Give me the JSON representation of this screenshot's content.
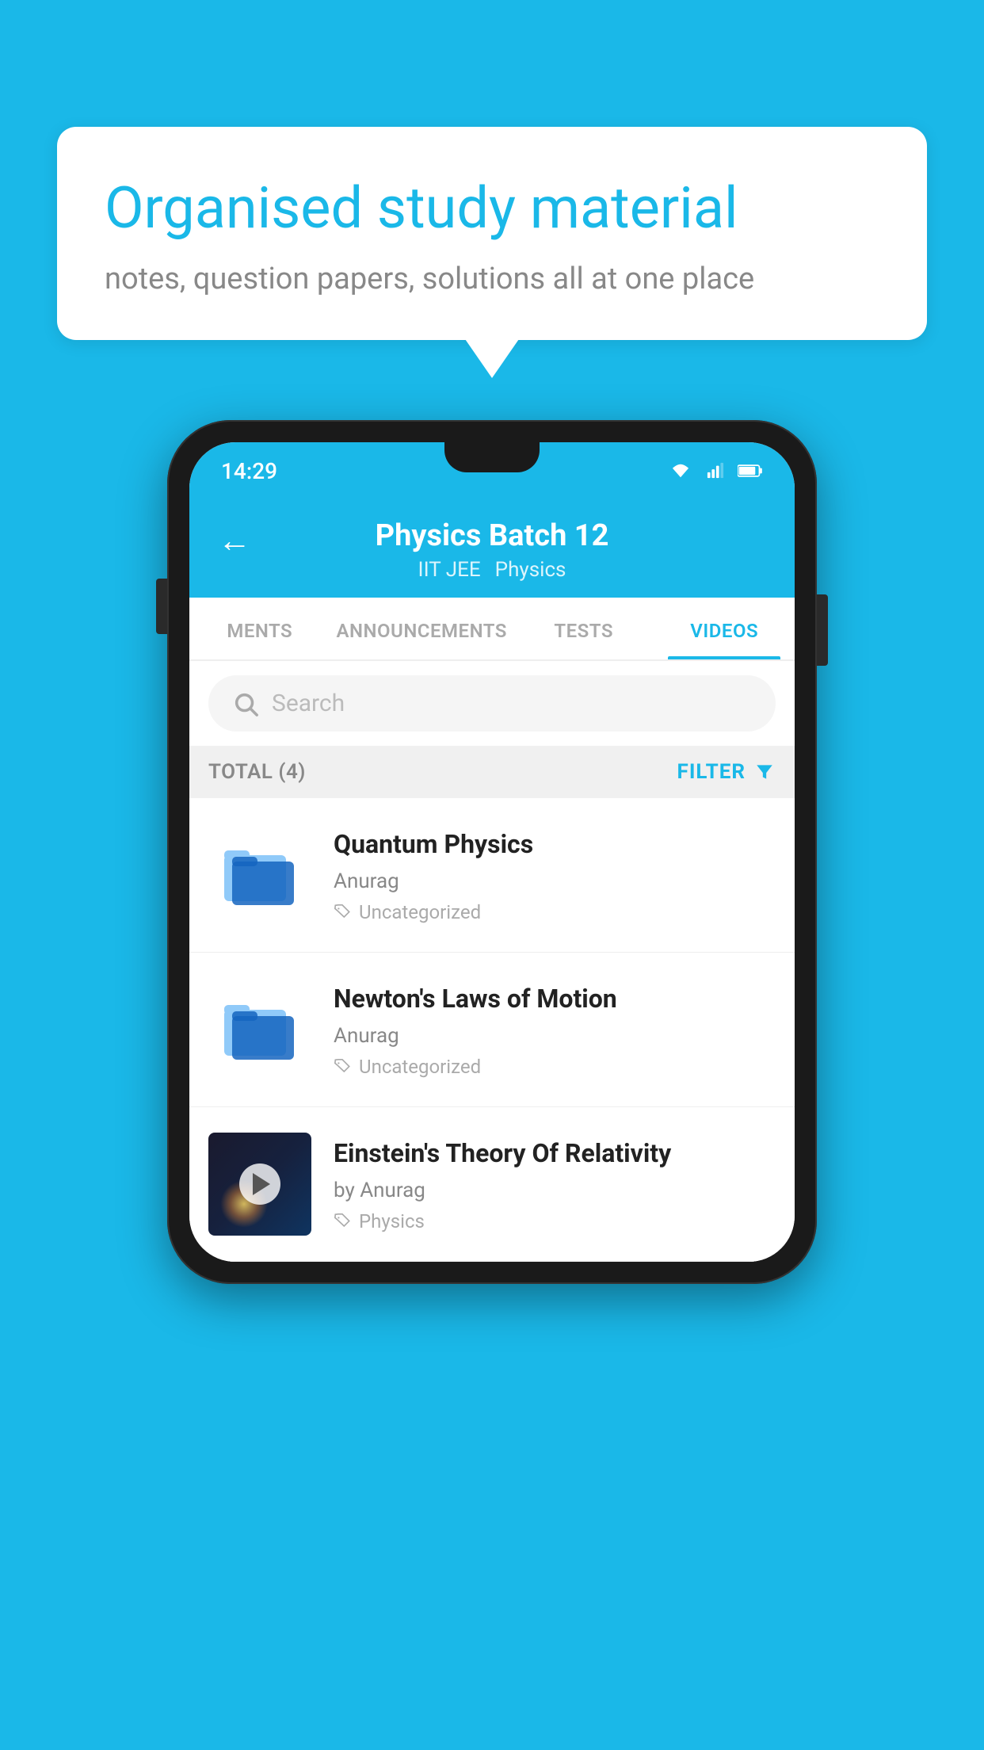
{
  "background_color": "#1ab8e8",
  "speech_bubble": {
    "title": "Organised study material",
    "subtitle": "notes, question papers, solutions all at one place"
  },
  "phone": {
    "status_bar": {
      "time": "14:29"
    },
    "header": {
      "back_label": "←",
      "title": "Physics Batch 12",
      "tag1": "IIT JEE",
      "tag2": "Physics"
    },
    "tabs": [
      {
        "label": "MENTS",
        "active": false
      },
      {
        "label": "ANNOUNCEMENTS",
        "active": false
      },
      {
        "label": "TESTS",
        "active": false
      },
      {
        "label": "VIDEOS",
        "active": true
      }
    ],
    "search": {
      "placeholder": "Search"
    },
    "filter": {
      "total_label": "TOTAL (4)",
      "filter_label": "FILTER"
    },
    "videos": [
      {
        "id": 1,
        "title": "Quantum Physics",
        "author": "Anurag",
        "tag": "Uncategorized",
        "has_thumbnail": false
      },
      {
        "id": 2,
        "title": "Newton's Laws of Motion",
        "author": "Anurag",
        "tag": "Uncategorized",
        "has_thumbnail": false
      },
      {
        "id": 3,
        "title": "Einstein's Theory Of Relativity",
        "author": "by Anurag",
        "tag": "Physics",
        "has_thumbnail": true
      }
    ]
  }
}
